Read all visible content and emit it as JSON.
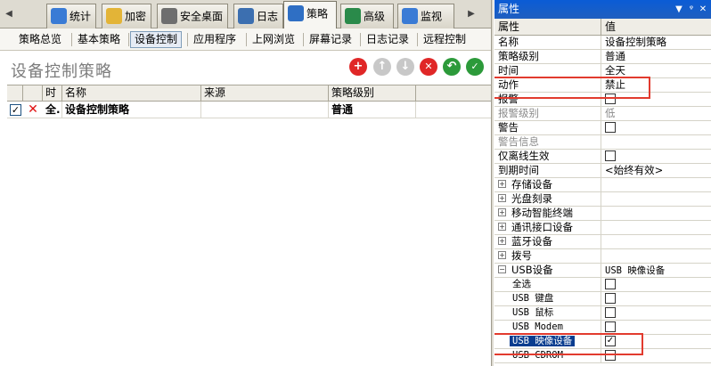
{
  "tabs": [
    {
      "label": "统计",
      "icon": "statistics-icon",
      "color": "#3a7bd5"
    },
    {
      "label": "加密",
      "icon": "lock-icon",
      "color": "#e3b437"
    },
    {
      "label": "安全桌面",
      "icon": "desktop-icon",
      "color": "#6e6e6e"
    },
    {
      "label": "日志",
      "icon": "log-icon",
      "color": "#3c6fb0"
    },
    {
      "label": "策略",
      "icon": "policy-icon",
      "color": "#2f6fc4"
    },
    {
      "label": "高级",
      "icon": "advanced-icon",
      "color": "#2a8a4a"
    },
    {
      "label": "监视",
      "icon": "monitor-icon",
      "color": "#3a7bd5"
    }
  ],
  "subtabs": [
    "策略总览",
    "基本策略",
    "设备控制",
    "应用程序",
    "上网浏览",
    "屏幕记录",
    "日志记录",
    "远程控制"
  ],
  "page_title": "设备控制策略",
  "grid": {
    "columns": [
      "时",
      "名称",
      "来源",
      "策略级别"
    ],
    "row": {
      "checked": "✓",
      "delete": "✕",
      "time": "全.",
      "name": "设备控制策略",
      "source": "",
      "level": "普通"
    }
  },
  "panel": {
    "title": "属性",
    "col_name": "属性",
    "col_value": "值",
    "rows": [
      {
        "name": "名称",
        "value": "设备控制策略"
      },
      {
        "name": "策略级别",
        "value": "普通"
      },
      {
        "name": "时间",
        "value": "全天"
      },
      {
        "name": "动作",
        "value": "禁止"
      },
      {
        "name": "报警",
        "checkbox": false
      },
      {
        "name": "报警级别",
        "value": "低",
        "dim": true
      },
      {
        "name": "警告",
        "checkbox": false
      },
      {
        "name": "警告信息",
        "value": "",
        "dim": true
      },
      {
        "name": "仅离线生效",
        "checkbox": false
      },
      {
        "name": "到期时间",
        "value": "<始终有效>"
      },
      {
        "name": "存储设备",
        "group": true,
        "expander": "+"
      },
      {
        "name": "光盘刻录",
        "group": true,
        "expander": "+"
      },
      {
        "name": "移动智能终端",
        "group": true,
        "expander": "+"
      },
      {
        "name": "通讯接口设备",
        "group": true,
        "expander": "+"
      },
      {
        "name": "蓝牙设备",
        "group": true,
        "expander": "+"
      },
      {
        "name": "拨号",
        "group": true,
        "expander": "+"
      },
      {
        "name": "USB设备",
        "value": "USB 映像设备",
        "group": true,
        "expander": "−"
      },
      {
        "name": "全选",
        "checkbox": false,
        "child": true
      },
      {
        "name": "USB 键盘",
        "checkbox": false,
        "child": true
      },
      {
        "name": "USB 鼠标",
        "checkbox": false,
        "child": true
      },
      {
        "name": "USB Modem",
        "checkbox": false,
        "child": true
      },
      {
        "name": "USB 映像设备",
        "checkbox": true,
        "child": true,
        "selected": true
      },
      {
        "name": "USB CDROM",
        "checkbox": false,
        "child": true
      }
    ]
  }
}
